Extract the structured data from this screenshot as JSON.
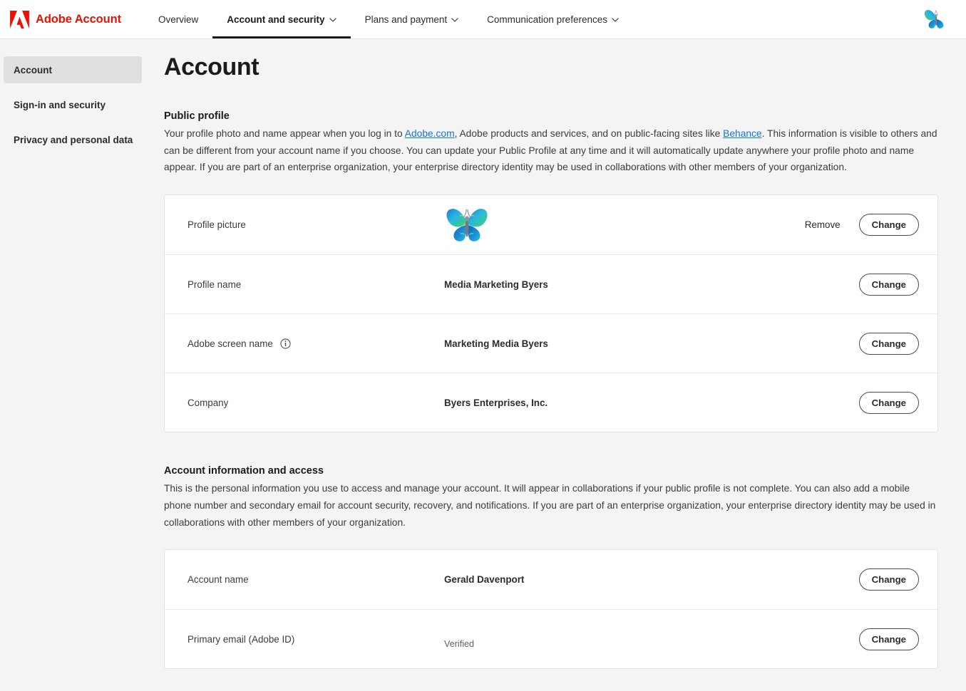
{
  "header": {
    "logo_icon": "adobe-logo-icon",
    "brand": "Adobe Account",
    "nav": [
      {
        "label": "Overview",
        "has_chevron": false,
        "active": false
      },
      {
        "label": "Account and security",
        "has_chevron": true,
        "active": true
      },
      {
        "label": "Plans and payment",
        "has_chevron": true,
        "active": false
      },
      {
        "label": "Communication preferences",
        "has_chevron": true,
        "active": false
      }
    ],
    "avatar_icon": "butterfly-avatar-icon"
  },
  "sidebar": {
    "items": [
      {
        "label": "Account",
        "selected": true
      },
      {
        "label": "Sign-in and security",
        "selected": false
      },
      {
        "label": "Privacy and personal data",
        "selected": false
      }
    ]
  },
  "main": {
    "title": "Account",
    "public_profile": {
      "heading": "Public profile",
      "desc_part1": "Your profile photo and name appear when you log in to ",
      "link1": "Adobe.com",
      "desc_part2": ", Adobe products and services, and on public-facing sites like ",
      "link2": "Behance",
      "desc_part3": ". This information is visible to others and can be different from your account name if you choose. You can update your Public Profile at any time and it will automatically update anywhere your profile photo and name appear. If you are part of an enterprise organization, your enterprise directory identity may be used in collaborations with other members of your organization.",
      "rows": [
        {
          "label": "Profile picture",
          "value": "",
          "icon": "butterfly-avatar-icon",
          "remove_label": "Remove",
          "change_label": "Change",
          "has_info": false
        },
        {
          "label": "Profile name",
          "value": "Media Marketing Byers",
          "change_label": "Change",
          "has_info": false
        },
        {
          "label": "Adobe screen name",
          "value": "Marketing Media Byers",
          "change_label": "Change",
          "has_info": true,
          "info_icon": "info-circle-icon"
        },
        {
          "label": "Company",
          "value": "Byers Enterprises, Inc.",
          "change_label": "Change",
          "has_info": false
        }
      ]
    },
    "account_info": {
      "heading": "Account information and access",
      "desc": "This is the personal information you use to access and manage your account. It will appear in collaborations if your public profile is not complete. You can also add a mobile phone number and secondary email for account security, recovery, and notifications. If you are part of an enterprise organization, your enterprise directory identity may be used in collaborations with other members of your organization.",
      "rows": [
        {
          "label": "Account name",
          "value": "Gerald Davenport",
          "change_label": "Change",
          "sub": ""
        },
        {
          "label": "Primary email (Adobe ID)",
          "value": "",
          "sub": "Verified",
          "change_label": "Change"
        }
      ]
    }
  },
  "colors": {
    "adobe_red": "#eb1000",
    "link_blue": "#1473e6",
    "page_bg": "#f4f4f4",
    "card_bg": "#ffffff",
    "text_dark": "#2c2c2c",
    "sidebar_selected": "#e0e0e0"
  }
}
